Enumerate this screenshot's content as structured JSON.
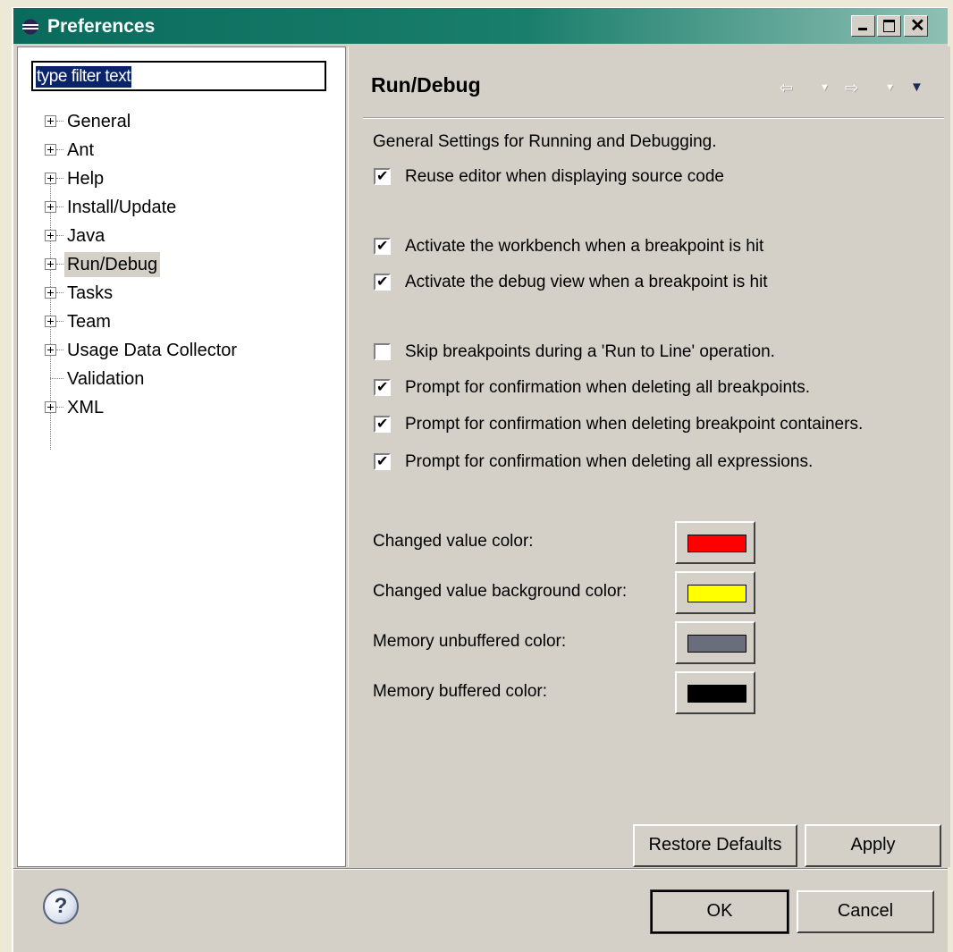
{
  "window": {
    "title": "Preferences"
  },
  "filter": {
    "value": "type filter text"
  },
  "tree": {
    "items": [
      {
        "label": "General",
        "expandable": true
      },
      {
        "label": "Ant",
        "expandable": true
      },
      {
        "label": "Help",
        "expandable": true
      },
      {
        "label": "Install/Update",
        "expandable": true
      },
      {
        "label": "Java",
        "expandable": true
      },
      {
        "label": "Run/Debug",
        "expandable": true,
        "selected": true
      },
      {
        "label": "Tasks",
        "expandable": true
      },
      {
        "label": "Team",
        "expandable": true
      },
      {
        "label": "Usage Data Collector",
        "expandable": true
      },
      {
        "label": "Validation",
        "expandable": false
      },
      {
        "label": "XML",
        "expandable": true
      }
    ]
  },
  "page": {
    "title": "Run/Debug",
    "description": "General Settings for Running and Debugging.",
    "checkboxes": [
      {
        "label": "Reuse editor when displaying source code",
        "checked": true
      },
      {
        "label": "Activate the workbench when a breakpoint is hit",
        "checked": true
      },
      {
        "label": "Activate the debug view when a breakpoint is hit",
        "checked": true
      },
      {
        "label": "Skip breakpoints during a 'Run to Line' operation.",
        "checked": false
      },
      {
        "label": "Prompt for confirmation when deleting all breakpoints.",
        "checked": true
      },
      {
        "label": "Prompt for confirmation when deleting breakpoint containers.",
        "checked": true
      },
      {
        "label": "Prompt for confirmation when deleting all expressions.",
        "checked": true
      }
    ],
    "colors": [
      {
        "label": "Changed value color:",
        "color": "#ff0000"
      },
      {
        "label": "Changed value background color:",
        "color": "#ffff00"
      },
      {
        "label": "Memory unbuffered color:",
        "color": "#6a6e7c"
      },
      {
        "label": "Memory buffered color:",
        "color": "#000000"
      }
    ],
    "restore_defaults": "Restore Defaults",
    "apply": "Apply"
  },
  "footer": {
    "ok": "OK",
    "cancel": "Cancel"
  },
  "icons": {
    "nav_back": "back-arrow-icon",
    "nav_forward": "forward-arrow-icon",
    "view_menu": "view-menu-icon",
    "help": "help-icon"
  }
}
